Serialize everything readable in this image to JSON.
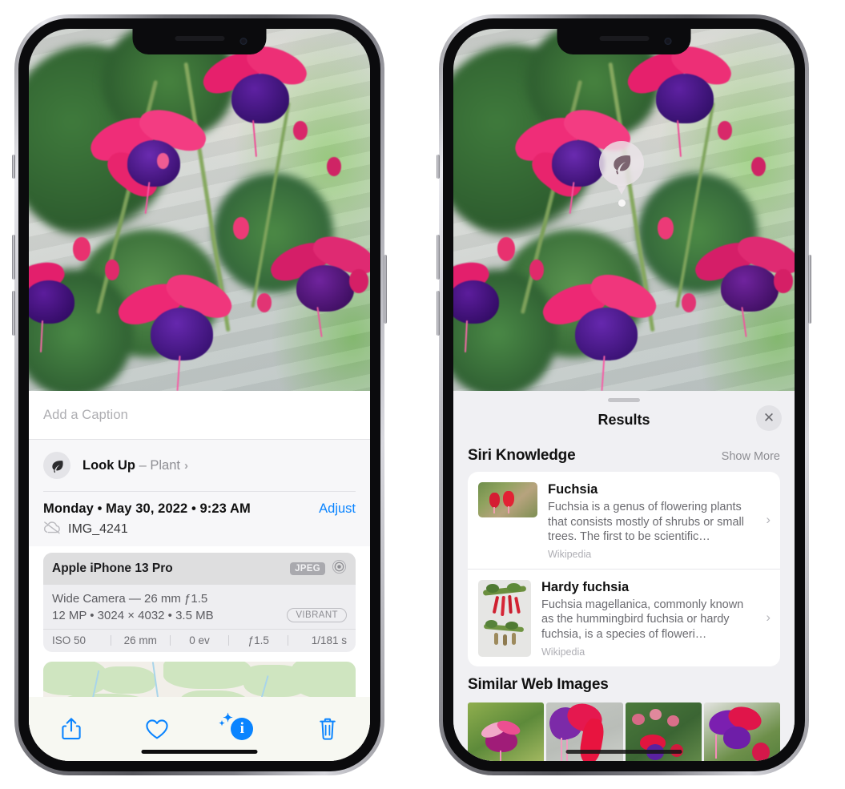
{
  "left_phone": {
    "photo_caption": {
      "placeholder": "Add a Caption",
      "value": ""
    },
    "lookup": {
      "label": "Look Up",
      "dash": "–",
      "subject": "Plant",
      "icon": "leaf-icon",
      "chevron": "›"
    },
    "metadata": {
      "date_line": "Monday • May 30, 2022 • 9:23 AM",
      "adjust_label": "Adjust",
      "filename": "IMG_4241",
      "cloud_icon": "cloud-slash-icon"
    },
    "exif_card": {
      "device": "Apple iPhone 13 Pro",
      "format_tag": "JPEG",
      "aperture_icon": "raw-circle-icon",
      "lens_line": "Wide Camera — 26 mm ƒ1.5",
      "size_line": "12 MP • 3024 × 4032 • 3.5 MB",
      "style_tag": "VIBRANT",
      "stats": [
        "ISO 50",
        "26 mm",
        "0 ev",
        "ƒ1.5",
        "1/181 s"
      ]
    },
    "map": {
      "pin_label": "photo-pin"
    },
    "toolbar": [
      {
        "name": "share-button",
        "icon": "share-icon",
        "label": "Share"
      },
      {
        "name": "favorite-button",
        "icon": "heart-icon",
        "label": "Favorite"
      },
      {
        "name": "info-button",
        "icon": "info-sparkle-icon",
        "label": "Info"
      },
      {
        "name": "delete-button",
        "icon": "trash-icon",
        "label": "Delete"
      }
    ]
  },
  "right_phone": {
    "visual_lookup_badge": {
      "icon": "leaf-icon",
      "name": "visual-lookup-badge"
    },
    "results": {
      "title": "Results",
      "close_label": "✕",
      "sections": [
        {
          "title": "Siri Knowledge",
          "action": "Show More",
          "items": [
            {
              "title": "Fuchsia",
              "description": "Fuchsia is a genus of flowering plants that consists mostly of shrubs or small trees. The first to be scientific…",
              "source": "Wikipedia",
              "chevron": "›"
            },
            {
              "title": "Hardy fuchsia",
              "description": "Fuchsia magellanica, commonly known as the hummingbird fuchsia or hardy fuchsia, is a species of floweri…",
              "source": "Wikipedia",
              "chevron": "›"
            }
          ]
        },
        {
          "title": "Similar Web Images",
          "action": "",
          "images": [
            "web-image-1",
            "web-image-2",
            "web-image-3",
            "web-image-4"
          ]
        }
      ]
    }
  },
  "colors": {
    "accent_blue": "#0a84ff",
    "sheet_bg": "#f0f0f3",
    "card_bg": "#ffffff",
    "tag_gray": "#a9a9ae",
    "secondary_text": "#8e8e93"
  }
}
